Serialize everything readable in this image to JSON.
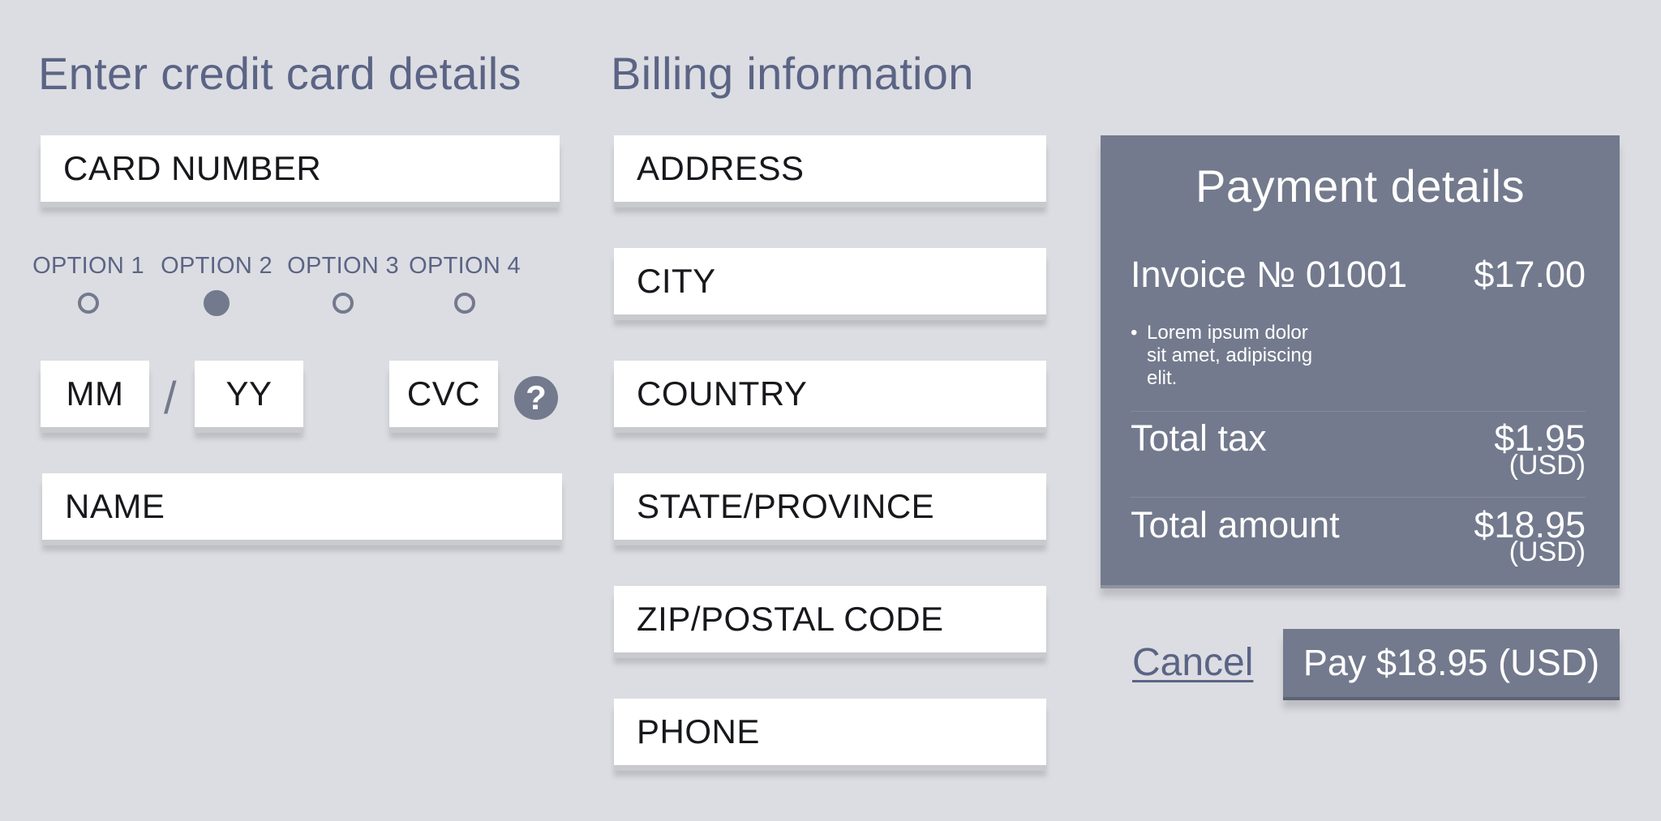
{
  "card_section": {
    "heading": "Enter credit card details",
    "card_number_placeholder": "CARD NUMBER",
    "options": [
      {
        "label": "OPTION 1",
        "selected": false
      },
      {
        "label": "OPTION 2",
        "selected": true
      },
      {
        "label": "OPTION 3",
        "selected": false
      },
      {
        "label": "OPTION 4",
        "selected": false
      }
    ],
    "month_placeholder": "MM",
    "separator": "/",
    "year_placeholder": "YY",
    "cvc_placeholder": "CVC",
    "help_glyph": "?",
    "name_placeholder": "NAME"
  },
  "billing_section": {
    "heading": "Billing information",
    "fields": [
      "ADDRESS",
      "CITY",
      "COUNTRY",
      "STATE/PROVINCE",
      "ZIP/POSTAL CODE",
      "PHONE"
    ]
  },
  "payment_details": {
    "title": "Payment details",
    "invoice_label": "Invoice № 01001",
    "invoice_amount": "$17.00",
    "invoice_note_bullet": "•",
    "invoice_note": "Lorem ipsum dolor sit amet, adipiscing elit.",
    "tax_label": "Total tax",
    "tax_amount": "$1.95",
    "tax_currency": "(USD)",
    "total_label": "Total amount",
    "total_amount": "$18.95",
    "total_currency": "(USD)"
  },
  "actions": {
    "cancel_label": "Cancel",
    "pay_label": "Pay $18.95 (USD)"
  },
  "colors": {
    "background": "#dcdde2",
    "accent": "#737a8d",
    "heading_text": "#5b6485",
    "field_background": "#ffffff"
  },
  "icons": {
    "help": "question-mark-circle-icon"
  }
}
